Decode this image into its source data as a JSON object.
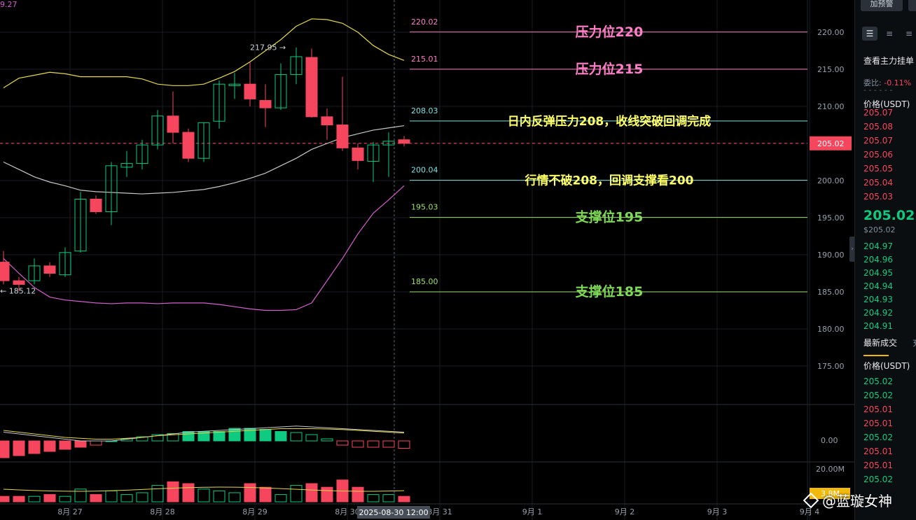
{
  "chart": {
    "corner_price": "9.27",
    "high_label": "217.95 →",
    "low_label": "← 185.12",
    "current_price_tag": "205.02",
    "current_time_tag": "2025-08-30 12:00",
    "volume_axis_label": "20.00M",
    "volume_tag": "3.8M",
    "macd_zero_label": "0.00",
    "price_axis_labels": [
      "220.00",
      "215.00",
      "210.00",
      "205.00",
      "200.00",
      "195.00",
      "190.00",
      "185.00",
      "180.00",
      "175.00"
    ],
    "date_labels": [
      "8月 27",
      "8月 28",
      "8月 29",
      "8月 30",
      "8月 31",
      "9月 1",
      "9月 2",
      "9月 3",
      "9月 4"
    ],
    "levels": [
      {
        "value": "220.02",
        "annotation": "压力位220",
        "color": "#ff7ec8",
        "annotation_color": "#ff7ec8"
      },
      {
        "value": "215.01",
        "annotation": "压力位215",
        "color": "#ff7ec8",
        "annotation_color": "#ff7ec8"
      },
      {
        "value": "208.03",
        "annotation": "日内反弹压力208，收线突破回调完成",
        "color": "#7fe0e0",
        "annotation_color": "#ffff66"
      },
      {
        "value": "200.04",
        "annotation": "行情不破208，回调支撑看200",
        "color": "#7fe0e0",
        "annotation_color": "#ffff66"
      },
      {
        "value": "195.03",
        "annotation": "支撑位195",
        "color": "#9ee36b",
        "annotation_color": "#7ed957"
      },
      {
        "value": "185.00",
        "annotation": "支撑位185",
        "color": "#9ee36b",
        "annotation_color": "#7ed957"
      }
    ],
    "colors": {
      "up": "#0ecb81",
      "down": "#f6465d",
      "upper_band": "#e6d84a",
      "mid_band": "#c8c8c8",
      "lower_band": "#d65fd0"
    }
  },
  "chart_data": {
    "type": "candlestick",
    "timeframe_hours": 4,
    "candles": [
      {
        "o": 189,
        "h": 190.5,
        "l": 186,
        "c": 186.5
      },
      {
        "o": 186.5,
        "h": 187,
        "l": 185.12,
        "c": 186
      },
      {
        "o": 186.5,
        "h": 189.5,
        "l": 186,
        "c": 188.5
      },
      {
        "o": 188.5,
        "h": 189,
        "l": 187,
        "c": 187.5
      },
      {
        "o": 187.3,
        "h": 191,
        "l": 187,
        "c": 190.3
      },
      {
        "o": 190.5,
        "h": 198.5,
        "l": 190.3,
        "c": 197.5
      },
      {
        "o": 197.5,
        "h": 198,
        "l": 195.5,
        "c": 195.8
      },
      {
        "o": 195.8,
        "h": 202.5,
        "l": 194,
        "c": 202
      },
      {
        "o": 201.8,
        "h": 204,
        "l": 200.5,
        "c": 202.3
      },
      {
        "o": 202.3,
        "h": 205.5,
        "l": 201.5,
        "c": 204.8
      },
      {
        "o": 204.8,
        "h": 209.5,
        "l": 204.2,
        "c": 208.7
      },
      {
        "o": 208.7,
        "h": 212,
        "l": 205,
        "c": 206.5
      },
      {
        "o": 206.5,
        "h": 207,
        "l": 202.5,
        "c": 203
      },
      {
        "o": 203,
        "h": 207.8,
        "l": 202.5,
        "c": 207.8
      },
      {
        "o": 208,
        "h": 213.5,
        "l": 207,
        "c": 213
      },
      {
        "o": 212.8,
        "h": 214.5,
        "l": 211,
        "c": 213
      },
      {
        "o": 213,
        "h": 216,
        "l": 210,
        "c": 211
      },
      {
        "o": 210.8,
        "h": 213,
        "l": 207.2,
        "c": 209.8
      },
      {
        "o": 209.8,
        "h": 215.8,
        "l": 209.5,
        "c": 214.3
      },
      {
        "o": 214.3,
        "h": 217.95,
        "l": 213,
        "c": 216.7
      },
      {
        "o": 216.6,
        "h": 217.8,
        "l": 208.5,
        "c": 208.6
      },
      {
        "o": 208.6,
        "h": 209.7,
        "l": 205.5,
        "c": 207.5
      },
      {
        "o": 207.5,
        "h": 214,
        "l": 204,
        "c": 204.4
      },
      {
        "o": 204.4,
        "h": 205,
        "l": 201.5,
        "c": 202.7
      },
      {
        "o": 202.6,
        "h": 205.2,
        "l": 199.8,
        "c": 204.8
      },
      {
        "o": 204.8,
        "h": 206.5,
        "l": 200.5,
        "c": 205.3
      },
      {
        "o": 205.5,
        "h": 206,
        "l": 204.6,
        "c": 205.02
      }
    ],
    "bollinger": {
      "upper": [
        212.5,
        213.8,
        214.2,
        214.6,
        214.4,
        214.0,
        214.0,
        214.0,
        214.0,
        213.7,
        213.0,
        212.8,
        212.8,
        213.0,
        213.8,
        214.7,
        216.0,
        217.5,
        219.0,
        220.8,
        221.8,
        221.7,
        221.2,
        220.0,
        218.2,
        217.0,
        216.2
      ],
      "middle": [
        202.5,
        201.5,
        200.5,
        199.8,
        199.3,
        198.7,
        198.5,
        198.4,
        198.3,
        198.2,
        198.3,
        198.4,
        198.6,
        198.8,
        199.2,
        199.7,
        200.3,
        201.0,
        202.0,
        203.0,
        204.2,
        205.0,
        205.8,
        206.3,
        206.8,
        207.1,
        207.4
      ],
      "lower": [
        189.5,
        187.5,
        185.6,
        184.3,
        183.9,
        183.7,
        183.5,
        183.4,
        183.5,
        183.5,
        183.4,
        183.5,
        183.5,
        183.5,
        183.3,
        183.0,
        182.7,
        182.5,
        182.5,
        182.6,
        183.5,
        186.5,
        189.5,
        192.8,
        195.6,
        197.4,
        199.3
      ]
    },
    "macd_hist": [
      -0.8,
      -0.7,
      -0.6,
      -0.5,
      -0.4,
      -0.3,
      -0.2,
      0,
      0.1,
      0.2,
      0.3,
      0.35,
      0.45,
      0.45,
      0.45,
      0.6,
      0.6,
      0.55,
      0.45,
      0.4,
      0.3,
      0.1,
      -0.2,
      -0.3,
      -0.3,
      -0.3,
      -0.35
    ],
    "macd_line1": [
      0.5,
      0.4,
      0.3,
      0.2,
      0.1,
      0,
      0,
      0,
      0.1,
      0.2,
      0.3,
      0.4,
      0.5,
      0.55,
      0.6,
      0.65,
      0.7,
      0.75,
      0.8,
      0.85,
      0.8,
      0.75,
      0.7,
      0.65,
      0.6,
      0.55,
      0.5
    ],
    "macd_line2": [
      0.6,
      0.5,
      0.4,
      0.3,
      0.2,
      0.15,
      0.1,
      0.1,
      0.15,
      0.2,
      0.3,
      0.35,
      0.4,
      0.45,
      0.5,
      0.55,
      0.6,
      0.65,
      0.7,
      0.7,
      0.7,
      0.68,
      0.65,
      0.6,
      0.55,
      0.5,
      0.45
    ],
    "volume": [
      0.3,
      0.3,
      0.3,
      0.4,
      0.3,
      0.7,
      0.4,
      0.6,
      0.4,
      0.5,
      0.9,
      1.1,
      1.0,
      0.7,
      0.6,
      0.5,
      1.0,
      0.8,
      0.4,
      0.9,
      1.0,
      0.8,
      1.2,
      0.8,
      0.4,
      0.4,
      0.3
    ]
  },
  "sidebar": {
    "alert_button": "加预警",
    "view_orders": "查看主力挂单",
    "ratio_label": "委比:",
    "ratio_value": "-0.11%",
    "price_header": "价格(USDT)",
    "asks": [
      "205.07",
      "205.08",
      "205.07",
      "205.06",
      "205.05",
      "205.04",
      "205.03"
    ],
    "last_price": "205.02",
    "last_price_usd": "$205.02",
    "bids": [
      "204.97",
      "204.96",
      "204.95",
      "204.94",
      "204.93",
      "204.92",
      "204.91"
    ],
    "trades_tab": "最新成交",
    "trades_tab2": "充",
    "trades_header": "价格(USDT)",
    "trades": [
      {
        "p": "205.02",
        "side": "green"
      },
      {
        "p": "205.02",
        "side": "green"
      },
      {
        "p": "205.01",
        "side": "red"
      },
      {
        "p": "205.01",
        "side": "red"
      },
      {
        "p": "205.02",
        "side": "green"
      },
      {
        "p": "205.01",
        "side": "red"
      },
      {
        "p": "205.01",
        "side": "red"
      },
      {
        "p": "205.02",
        "side": "green"
      }
    ]
  },
  "watermark": "@蓝璇女神"
}
